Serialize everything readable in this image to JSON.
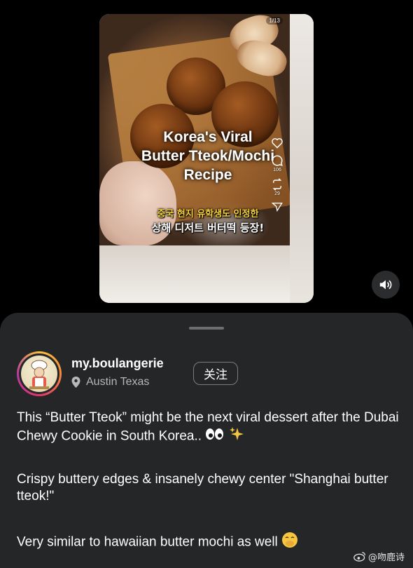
{
  "post": {
    "page_counter": "1/13",
    "overlay_title_line1": "Korea's Viral",
    "overlay_title_line2": "Butter Tteok/Mochi",
    "overlay_title_line3": "Recipe",
    "korean_line1": "중국 현지 유학생도 인정한",
    "korean_line2": "상해 디저트 버터떡 등장!",
    "actions": [
      {
        "icon": "heart-icon",
        "count": ""
      },
      {
        "icon": "comment-icon",
        "count": "106"
      },
      {
        "icon": "repost-icon",
        "count": "29"
      },
      {
        "icon": "send-icon",
        "count": ""
      }
    ]
  },
  "sound": {
    "icon": "speaker-icon"
  },
  "profile": {
    "username": "my.boulangerie",
    "location": "Austin Texas",
    "follow_label": "关注"
  },
  "caption": {
    "line1": "This “Butter Tteok” might be the next viral dessert after the Dubai Chewy Cookie in South Korea..",
    "line2": "Crispy buttery edges &  insanely chewy center \"Shanghai butter tteok!\"",
    "line3": "Very similar to hawaiian butter mochi as well"
  },
  "watermark": {
    "text": "@吻鹿诗",
    "icon": "weibo-icon"
  }
}
